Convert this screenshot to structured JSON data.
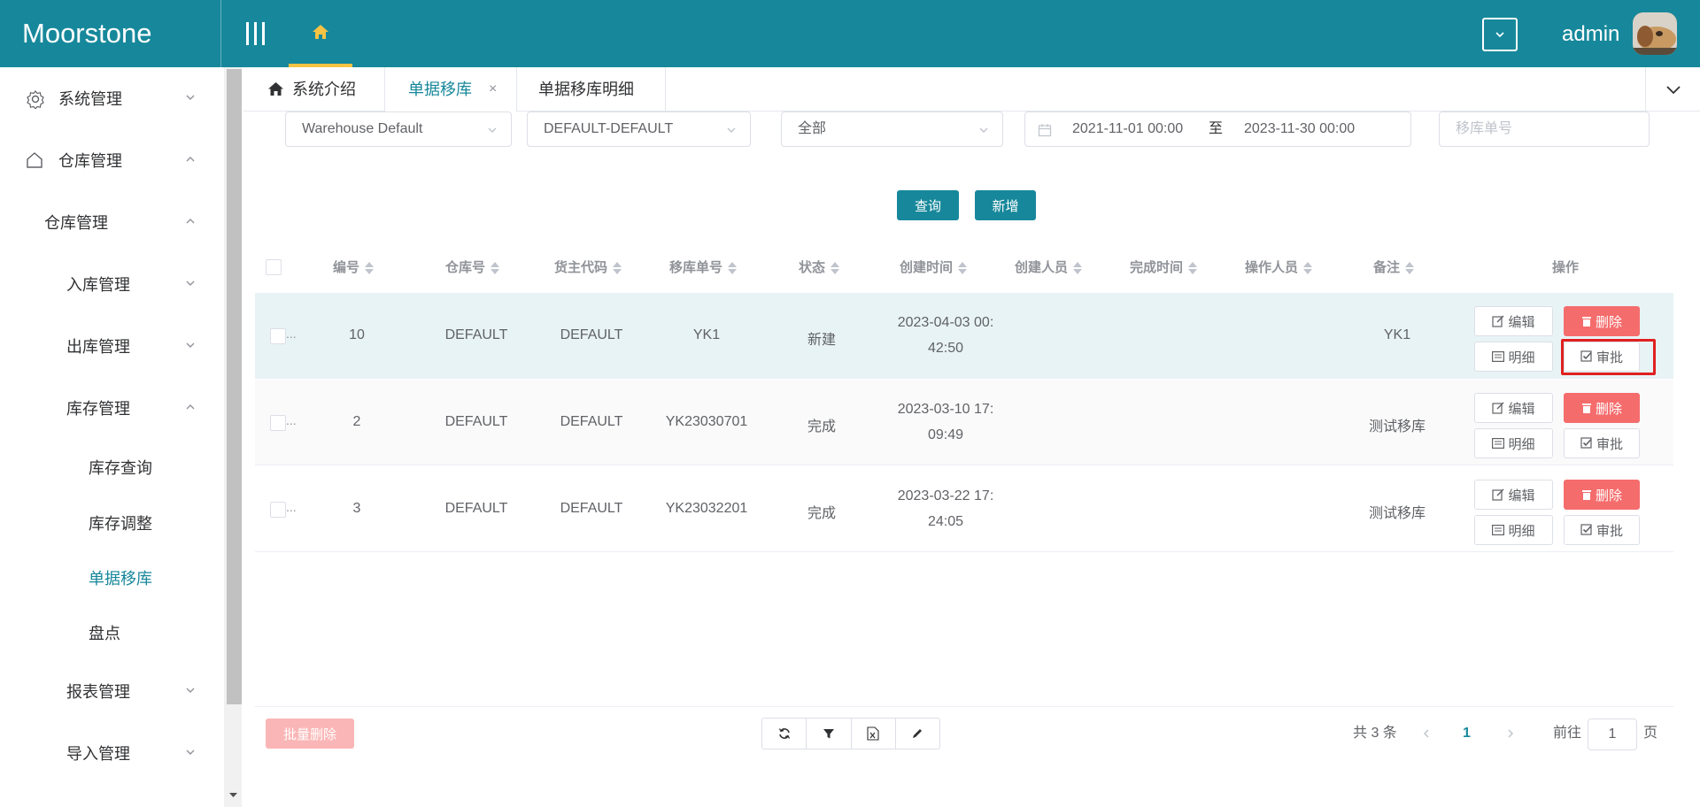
{
  "header": {
    "logo": "Moorstone",
    "user": "admin"
  },
  "sidebar": {
    "items": [
      {
        "label": "系统管理"
      },
      {
        "label": "仓库管理"
      },
      {
        "label": "仓库管理"
      },
      {
        "label": "入库管理"
      },
      {
        "label": "出库管理"
      },
      {
        "label": "库存管理"
      },
      {
        "label": "库存查询"
      },
      {
        "label": "库存调整"
      },
      {
        "label": "单据移库"
      },
      {
        "label": "盘点"
      },
      {
        "label": "报表管理"
      },
      {
        "label": "导入管理"
      }
    ]
  },
  "tabs": [
    {
      "label": "系统介绍"
    },
    {
      "label": "单据移库"
    },
    {
      "label": "单据移库明细"
    }
  ],
  "filters": {
    "warehouse": "Warehouse Default",
    "owner": "DEFAULT-DEFAULT",
    "status": "全部",
    "date_start": "2021-11-01 00:00",
    "date_sep": "至",
    "date_end": "2023-11-30 00:00",
    "order_no_placeholder": "移库单号"
  },
  "buttons": {
    "query": "查询",
    "add": "新增"
  },
  "table": {
    "headers": [
      "编号",
      "仓库号",
      "货主代码",
      "移库单号",
      "状态",
      "创建时间",
      "创建人员",
      "完成时间",
      "操作人员",
      "备注",
      "操作"
    ],
    "rows": [
      {
        "id": "10",
        "warehouse": "DEFAULT",
        "owner": "DEFAULT",
        "order_no": "YK1",
        "status": "新建",
        "created_a": "2023-04-03 00:",
        "created_b": "42:50",
        "remark": "YK1"
      },
      {
        "id": "2",
        "warehouse": "DEFAULT",
        "owner": "DEFAULT",
        "order_no": "YK23030701",
        "status": "完成",
        "created_a": "2023-03-10 17:",
        "created_b": "09:49",
        "remark": "测试移库"
      },
      {
        "id": "3",
        "warehouse": "DEFAULT",
        "owner": "DEFAULT",
        "order_no": "YK23032201",
        "status": "完成",
        "created_a": "2023-03-22 17:",
        "created_b": "24:05",
        "remark": "测试移库"
      }
    ],
    "ops": {
      "edit": "编辑",
      "delete": "删除",
      "detail": "明细",
      "approve": "审批"
    },
    "ellipsis": "..."
  },
  "footer": {
    "batch_delete": "批量删除",
    "total": "共 3 条",
    "current_page": "1",
    "goto": "前往",
    "goto_value": "1",
    "page_unit": "页"
  },
  "colors": {
    "primary": "#17889b",
    "danger": "#f56c6c",
    "highlight": "#e02020",
    "accent": "#f6c344"
  }
}
